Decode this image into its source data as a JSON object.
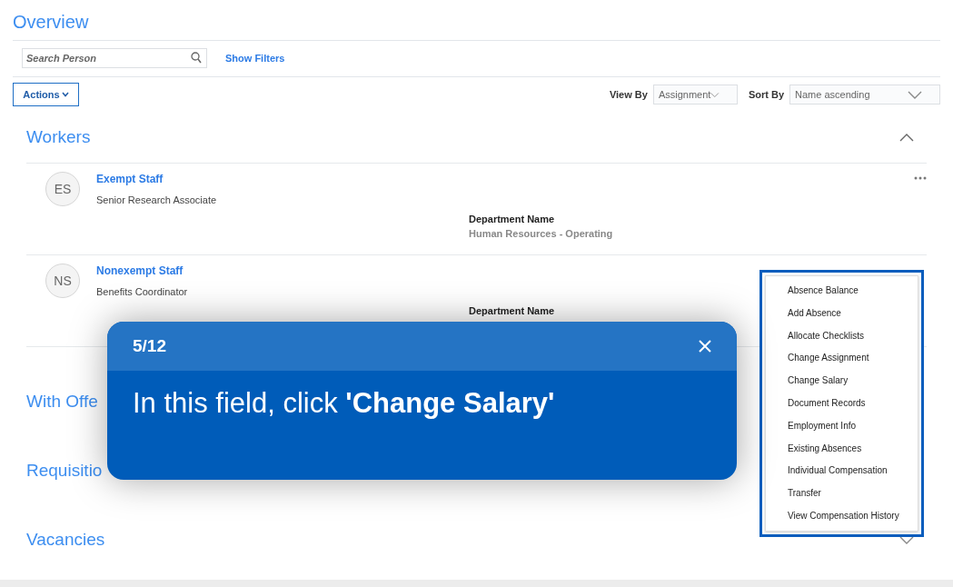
{
  "page_title": "Overview",
  "search": {
    "placeholder": "Search Person"
  },
  "show_filters": "Show Filters",
  "actions_button": "Actions",
  "view_by": {
    "label": "View By",
    "value": "Assignment"
  },
  "sort_by": {
    "label": "Sort By",
    "value": "Name ascending"
  },
  "workers": {
    "title": "Workers",
    "expanded": true,
    "rows": [
      {
        "initials": "ES",
        "name": "Exempt Staff",
        "job": "Senior Research Associate",
        "dept_label": "Department Name",
        "dept_value": "Human Resources - Operating"
      },
      {
        "initials": "NS",
        "name": "Nonexempt Staff",
        "job": "Benefits Coordinator",
        "dept_label": "Department Name"
      }
    ]
  },
  "sections": [
    {
      "title": "With Offe"
    },
    {
      "title": "Requisitio"
    },
    {
      "title": "Vacancies",
      "expanded": false
    }
  ],
  "menu": {
    "items": [
      "Absence Balance",
      "Add Absence",
      "Allocate Checklists",
      "Change Assignment",
      "Change Salary",
      "Document Records",
      "Employment Info",
      "Existing Absences",
      "Individual Compensation",
      "Transfer",
      "View Compensation History"
    ]
  },
  "tour": {
    "step": "5/12",
    "message": "In this field, click **'Change Salary'**"
  }
}
